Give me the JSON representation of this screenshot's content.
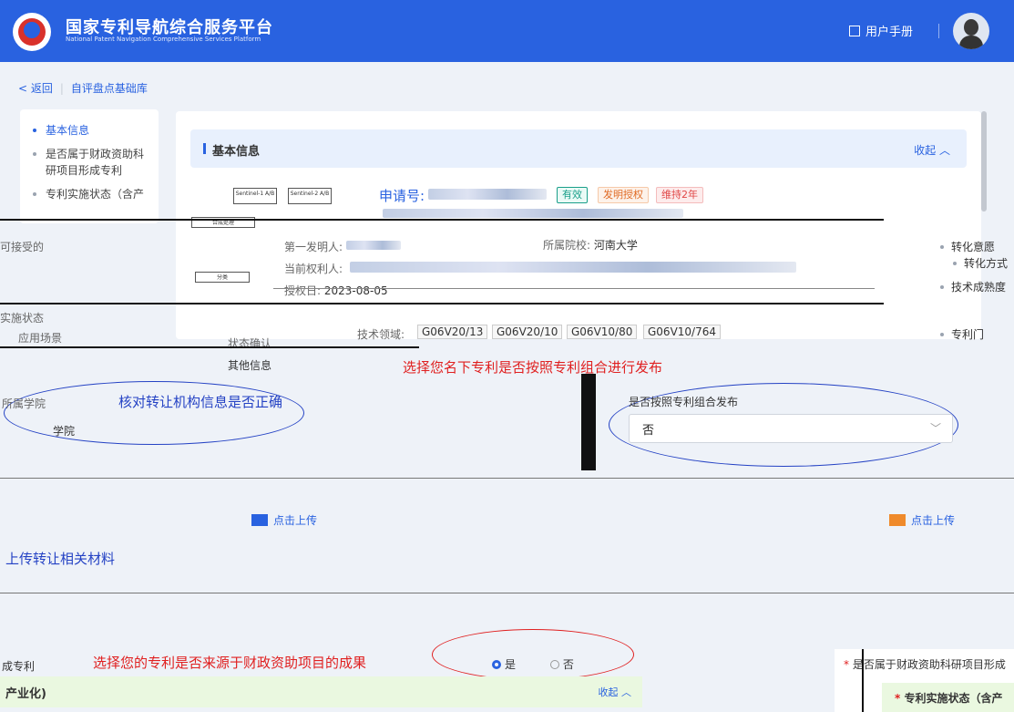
{
  "header": {
    "title": "国家专利导航综合服务平台",
    "subtitle": "National Patent Navigation Comprehensive Services Platform",
    "manual_label": "用户手册"
  },
  "breadcrumb": {
    "back": "< 返回",
    "current": "自评盘点基础库"
  },
  "sidenav": {
    "items": [
      {
        "label": "基本信息",
        "active": true
      },
      {
        "label": "是否属于财政资助科研项目形成专利",
        "active": false
      },
      {
        "label": "专利实施状态（含产",
        "active": false
      }
    ],
    "extra_label": "其他信息"
  },
  "basic_card": {
    "title": "基本信息",
    "fold_label": "收起 ︿",
    "app_no_label": "申请号:",
    "tags": {
      "valid": "有效",
      "grant": "发明授权",
      "keep": "维持2年"
    },
    "school_label": "所属院校:",
    "school_value": "河南大学",
    "first_inventor_label": "第一发明人:",
    "rights_holder_label": "当前权利人:",
    "grant_date_label": "授权日:",
    "grant_date_value": "2023-08-05",
    "tech_field_label": "技术领域:",
    "ipc_codes": [
      "G06V20/13",
      "G06V20/10",
      "G06V10/80",
      "G06V10/764"
    ],
    "status_label": "状态确认"
  },
  "flowchart": {
    "box1": "Sentinel-1 A/B",
    "box2": "Sentinel-2 A/B",
    "box3": "合成处理",
    "box4": "分类"
  },
  "right_panel": {
    "item1": "转化意愿",
    "item1b": "转化方式",
    "item2": "技术成熟度",
    "item3": "专利门"
  },
  "annotations": {
    "note_portfolio": "选择您名下专利是否按照专利组合进行发布",
    "note_verify": "核对转让机构信息是否正确",
    "note_upload": "上传转让相关材料",
    "note_funded": "选择您的专利是否来源于财政资助项目的成果"
  },
  "portfolio": {
    "field_label": "是否按照专利组合发布",
    "select_value": "否",
    "select_chevron": "﹀"
  },
  "agency": {
    "school_suffix": "学院",
    "label": "所属学院"
  },
  "uploads": {
    "click_upload": "点击上传"
  },
  "funding": {
    "question": "成专利",
    "yes": "是",
    "no": "否"
  },
  "industrial": {
    "title": "产业化)",
    "fold_label": "收起 ︿"
  },
  "side_card": {
    "row1": "是否属于财政资助科研项目形成",
    "row2": "专利实施状态（含产"
  },
  "fragments": {
    "left_top": "可接受的",
    "left_mid": "实施状态",
    "left_lower": "应用场景"
  }
}
